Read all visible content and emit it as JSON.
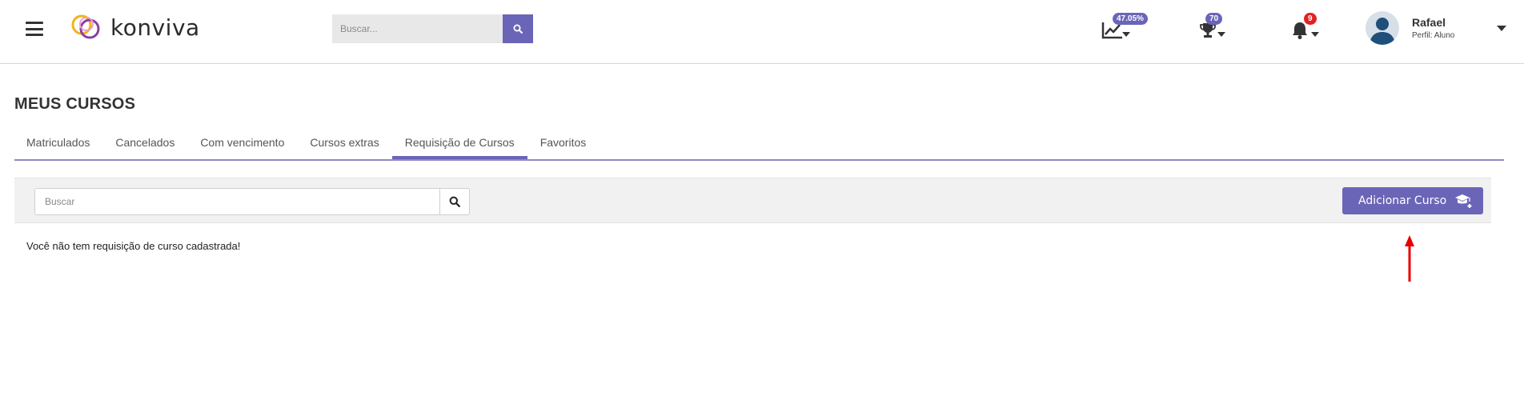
{
  "header": {
    "logo_text": "konviva",
    "search_placeholder": "Buscar...",
    "progress_badge": "47.05%",
    "trophy_badge": "70",
    "notifications_badge": "9",
    "user_name": "Rafael",
    "user_role": "Perfil: Aluno",
    "colors": {
      "accent": "#6b65b8",
      "notification": "#e02424"
    }
  },
  "page": {
    "title": "MEUS CURSOS",
    "tabs": [
      {
        "label": "Matriculados"
      },
      {
        "label": "Cancelados"
      },
      {
        "label": "Com vencimento"
      },
      {
        "label": "Cursos extras"
      },
      {
        "label": "Requisição de Cursos",
        "active": true
      },
      {
        "label": "Favoritos"
      }
    ],
    "filter": {
      "search_placeholder": "Buscar",
      "add_button_label": "Adicionar Curso"
    },
    "empty_message": "Você não tem requisição de curso cadastrada!"
  },
  "icons": {
    "menu": "hamburger-icon",
    "search": "search-icon",
    "progress": "chart-line-icon",
    "trophy": "trophy-icon",
    "bell": "bell-icon",
    "add_course": "graduation-cap-plus-icon",
    "annotation": "red-arrow"
  }
}
